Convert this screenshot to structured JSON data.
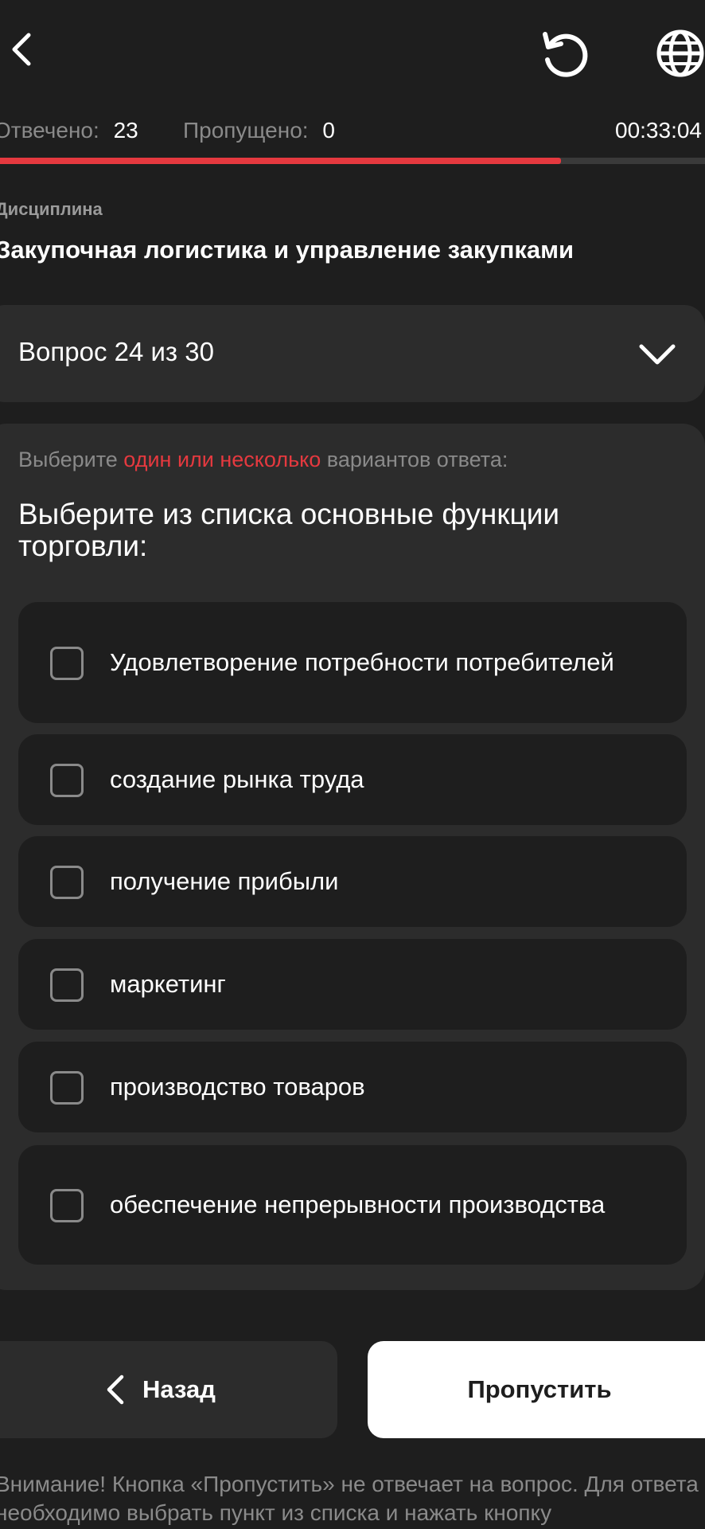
{
  "header": {
    "back_icon": "chevron-left-icon",
    "reset_icon": "rotate-ccw-icon",
    "language_icon": "globe-icon"
  },
  "stats": {
    "answered_label": "Отвечено:",
    "answered_value": "23",
    "skipped_label": "Пропущено:",
    "skipped_value": "0",
    "timer": "00:33:04"
  },
  "progress": {
    "fraction": 0.796
  },
  "discipline": {
    "label": "Дисциплина",
    "title": "Закупочная логистика и управление закупками"
  },
  "question_selector": {
    "label": "Вопрос 24 из 30",
    "icon": "chevron-down-icon"
  },
  "question": {
    "instruction_prefix": "Выберите ",
    "instruction_accent": "один или несколько",
    "instruction_suffix": " вариантов ответа:",
    "text": "Выберите из списка основные функции торговли:",
    "options": [
      {
        "label": "Удовлетворение потребности потребителей",
        "checked": false
      },
      {
        "label": "создание рынка труда",
        "checked": false
      },
      {
        "label": "получение прибыли",
        "checked": false
      },
      {
        "label": "маркетинг",
        "checked": false
      },
      {
        "label": "производство товаров",
        "checked": false
      },
      {
        "label": "обеспечение непрерывности производства",
        "checked": false
      }
    ]
  },
  "footer": {
    "back_label": "Назад",
    "skip_label": "Пропустить",
    "notice": "Внимание! Кнопка «Пропустить» не отвечает на вопрос. Для ответа необходимо выбрать пункт из списка и нажать кнопку"
  },
  "colors": {
    "background": "#1e1e1e",
    "card": "#2c2c2c",
    "accent": "#e5393f",
    "muted_text": "#8a8a8a",
    "primary_button": "#ffffff"
  }
}
